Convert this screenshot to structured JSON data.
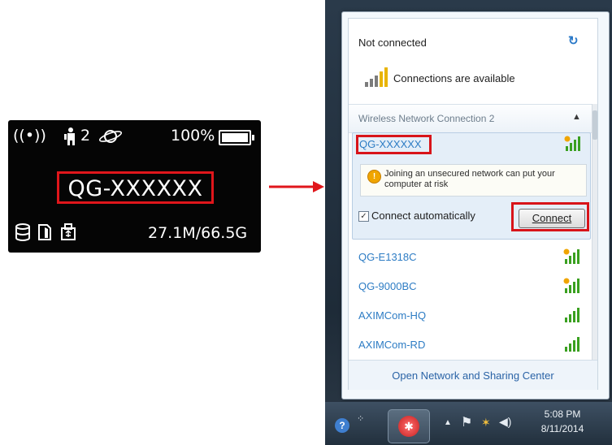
{
  "device": {
    "user_count": "2",
    "battery_percent": "100%",
    "ssid": "QG-XXXXXX",
    "data_usage": "27.1M/66.5G",
    "icons": [
      "wifi-broadcast-icon",
      "user-icon",
      "globe-icon",
      "battery-icon",
      "database-icon",
      "sd-card-icon",
      "usb-icon"
    ]
  },
  "network_panel": {
    "status_title": "Not connected",
    "availability": "Connections are available",
    "section_label": "Wireless Network Connection 2",
    "selected_network": {
      "name": "QG-XXXXXX",
      "warning": "Joining an unsecured network can put your computer at risk",
      "auto_connect_label": "Connect automatically",
      "auto_connect_checked": true,
      "connect_button": "Connect"
    },
    "networks": [
      {
        "name": "QG-E1318C",
        "secured": false
      },
      {
        "name": "QG-9000BC",
        "secured": false
      },
      {
        "name": "AXIMCom-HQ",
        "secured": true
      },
      {
        "name": "AXIMCom-RD",
        "secured": true
      }
    ],
    "footer_link": "Open Network and Sharing Center"
  },
  "taskbar": {
    "time": "5:08 PM",
    "date": "8/11/2014"
  },
  "colors": {
    "highlight_red": "#d8141a",
    "link_blue": "#2d7cc4"
  }
}
